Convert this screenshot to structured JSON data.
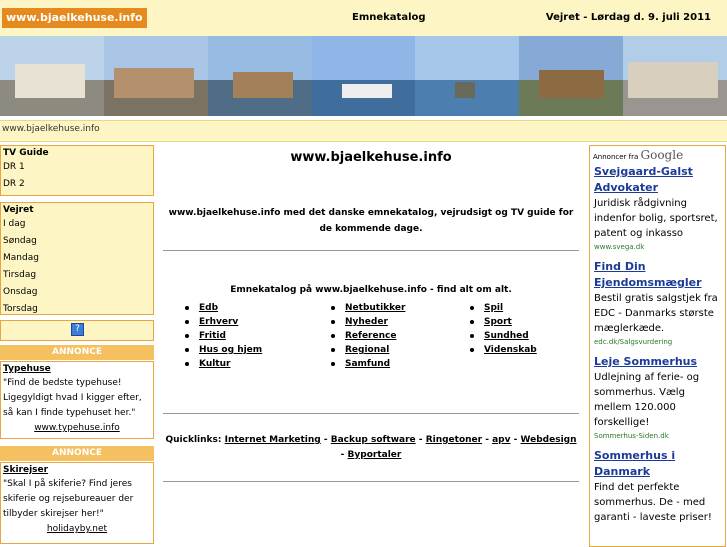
{
  "top": {
    "site": "www.bjaelkehuse.info",
    "center": "Emnekatalog",
    "right": "Vejret - Lørdag d. 9. juli 2011"
  },
  "urlbar": "www.bjaelkehuse.info",
  "tv": {
    "title": "TV Guide",
    "items": [
      "DR 1",
      "DR 2"
    ]
  },
  "weather": {
    "title": "Vejret",
    "items": [
      "I dag",
      "Søndag",
      "Mandag",
      "Tirsdag",
      "Onsdag",
      "Torsdag"
    ]
  },
  "help_icon": "?",
  "annonce_label": "ANNONCE",
  "left_ads": [
    {
      "title": "Typehuse",
      "desc": "\"Find de bedste typehuse! Ligegyldigt hvad I kigger efter, så kan I finde typehuset her.\"",
      "url": "www.typehuse.info"
    },
    {
      "title": "Skirejser",
      "desc": "\"Skal I på skiferie? Find jeres skiferie og rejsebureauer der tilbyder skirejser her!\"",
      "url": "holidayby.net"
    }
  ],
  "main": {
    "heading": "www.bjaelkehuse.info",
    "intro": "www.bjaelkehuse.info med det danske emnekatalog, vejrudsigt og TV guide for de kommende dage.",
    "cat_title": "Emnekatalog på www.bjaelkehuse.info - find alt om alt.",
    "col1": [
      "Edb",
      "Erhverv",
      "Fritid",
      "Hus og hjem",
      "Kultur"
    ],
    "col2": [
      "Netbutikker",
      "Nyheder",
      "Reference",
      "Regional",
      "Samfund"
    ],
    "col3": [
      "Spil",
      "Sport",
      "Sundhed",
      "Videnskab"
    ],
    "quick_label": "Quicklinks:",
    "quick_links": [
      "Internet Marketing",
      "Backup software",
      "Ringetoner",
      "apv",
      "Webdesign",
      "Byportaler"
    ]
  },
  "google": {
    "prefix": "Annoncer fra",
    "brand": "Google",
    "ads": [
      {
        "title": "Svejgaard-Galst Advokater",
        "desc": "Juridisk rådgivning indenfor bolig, sportsret, patent og inkasso",
        "url": "www.svega.dk"
      },
      {
        "title": "Find Din Ejendomsmægler",
        "desc": "Bestil gratis salgstjek fra EDC - Danmarks største mæglerkæde.",
        "url": "edc.dk/Salgsvurdering"
      },
      {
        "title": "Leje Sommerhus",
        "desc": "Udlejning af ferie- og sommerhus. Vælg mellem 120.000 forskellige!",
        "url": "Sommerhus-Siden.dk"
      },
      {
        "title": "Sommerhus i Danmark",
        "desc": "Find det perfekte sommerhus. De - med garanti - laveste priser!",
        "url": ""
      }
    ]
  },
  "colors": {
    "accent": "#e48a1e",
    "bg_yellow": "#fdf6c4",
    "border": "#e8a640",
    "ad_link": "#1b3a9a"
  }
}
